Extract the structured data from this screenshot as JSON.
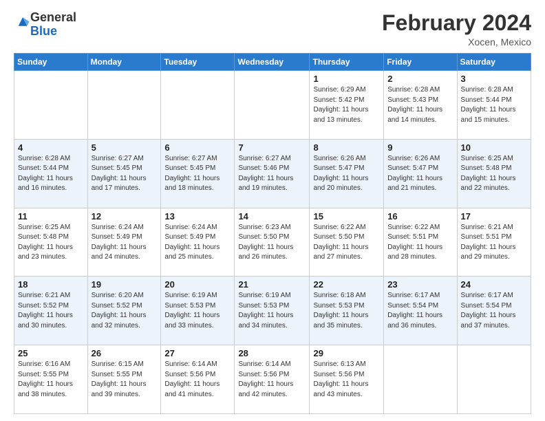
{
  "header": {
    "logo_general": "General",
    "logo_blue": "Blue",
    "month_year": "February 2024",
    "location": "Xocen, Mexico"
  },
  "days_of_week": [
    "Sunday",
    "Monday",
    "Tuesday",
    "Wednesday",
    "Thursday",
    "Friday",
    "Saturday"
  ],
  "weeks": [
    [
      {
        "day": "",
        "info": ""
      },
      {
        "day": "",
        "info": ""
      },
      {
        "day": "",
        "info": ""
      },
      {
        "day": "",
        "info": ""
      },
      {
        "day": "1",
        "info": "Sunrise: 6:29 AM\nSunset: 5:42 PM\nDaylight: 11 hours\nand 13 minutes."
      },
      {
        "day": "2",
        "info": "Sunrise: 6:28 AM\nSunset: 5:43 PM\nDaylight: 11 hours\nand 14 minutes."
      },
      {
        "day": "3",
        "info": "Sunrise: 6:28 AM\nSunset: 5:44 PM\nDaylight: 11 hours\nand 15 minutes."
      }
    ],
    [
      {
        "day": "4",
        "info": "Sunrise: 6:28 AM\nSunset: 5:44 PM\nDaylight: 11 hours\nand 16 minutes."
      },
      {
        "day": "5",
        "info": "Sunrise: 6:27 AM\nSunset: 5:45 PM\nDaylight: 11 hours\nand 17 minutes."
      },
      {
        "day": "6",
        "info": "Sunrise: 6:27 AM\nSunset: 5:45 PM\nDaylight: 11 hours\nand 18 minutes."
      },
      {
        "day": "7",
        "info": "Sunrise: 6:27 AM\nSunset: 5:46 PM\nDaylight: 11 hours\nand 19 minutes."
      },
      {
        "day": "8",
        "info": "Sunrise: 6:26 AM\nSunset: 5:47 PM\nDaylight: 11 hours\nand 20 minutes."
      },
      {
        "day": "9",
        "info": "Sunrise: 6:26 AM\nSunset: 5:47 PM\nDaylight: 11 hours\nand 21 minutes."
      },
      {
        "day": "10",
        "info": "Sunrise: 6:25 AM\nSunset: 5:48 PM\nDaylight: 11 hours\nand 22 minutes."
      }
    ],
    [
      {
        "day": "11",
        "info": "Sunrise: 6:25 AM\nSunset: 5:48 PM\nDaylight: 11 hours\nand 23 minutes."
      },
      {
        "day": "12",
        "info": "Sunrise: 6:24 AM\nSunset: 5:49 PM\nDaylight: 11 hours\nand 24 minutes."
      },
      {
        "day": "13",
        "info": "Sunrise: 6:24 AM\nSunset: 5:49 PM\nDaylight: 11 hours\nand 25 minutes."
      },
      {
        "day": "14",
        "info": "Sunrise: 6:23 AM\nSunset: 5:50 PM\nDaylight: 11 hours\nand 26 minutes."
      },
      {
        "day": "15",
        "info": "Sunrise: 6:22 AM\nSunset: 5:50 PM\nDaylight: 11 hours\nand 27 minutes."
      },
      {
        "day": "16",
        "info": "Sunrise: 6:22 AM\nSunset: 5:51 PM\nDaylight: 11 hours\nand 28 minutes."
      },
      {
        "day": "17",
        "info": "Sunrise: 6:21 AM\nSunset: 5:51 PM\nDaylight: 11 hours\nand 29 minutes."
      }
    ],
    [
      {
        "day": "18",
        "info": "Sunrise: 6:21 AM\nSunset: 5:52 PM\nDaylight: 11 hours\nand 30 minutes."
      },
      {
        "day": "19",
        "info": "Sunrise: 6:20 AM\nSunset: 5:52 PM\nDaylight: 11 hours\nand 32 minutes."
      },
      {
        "day": "20",
        "info": "Sunrise: 6:19 AM\nSunset: 5:53 PM\nDaylight: 11 hours\nand 33 minutes."
      },
      {
        "day": "21",
        "info": "Sunrise: 6:19 AM\nSunset: 5:53 PM\nDaylight: 11 hours\nand 34 minutes."
      },
      {
        "day": "22",
        "info": "Sunrise: 6:18 AM\nSunset: 5:53 PM\nDaylight: 11 hours\nand 35 minutes."
      },
      {
        "day": "23",
        "info": "Sunrise: 6:17 AM\nSunset: 5:54 PM\nDaylight: 11 hours\nand 36 minutes."
      },
      {
        "day": "24",
        "info": "Sunrise: 6:17 AM\nSunset: 5:54 PM\nDaylight: 11 hours\nand 37 minutes."
      }
    ],
    [
      {
        "day": "25",
        "info": "Sunrise: 6:16 AM\nSunset: 5:55 PM\nDaylight: 11 hours\nand 38 minutes."
      },
      {
        "day": "26",
        "info": "Sunrise: 6:15 AM\nSunset: 5:55 PM\nDaylight: 11 hours\nand 39 minutes."
      },
      {
        "day": "27",
        "info": "Sunrise: 6:14 AM\nSunset: 5:56 PM\nDaylight: 11 hours\nand 41 minutes."
      },
      {
        "day": "28",
        "info": "Sunrise: 6:14 AM\nSunset: 5:56 PM\nDaylight: 11 hours\nand 42 minutes."
      },
      {
        "day": "29",
        "info": "Sunrise: 6:13 AM\nSunset: 5:56 PM\nDaylight: 11 hours\nand 43 minutes."
      },
      {
        "day": "",
        "info": ""
      },
      {
        "day": "",
        "info": ""
      }
    ]
  ]
}
